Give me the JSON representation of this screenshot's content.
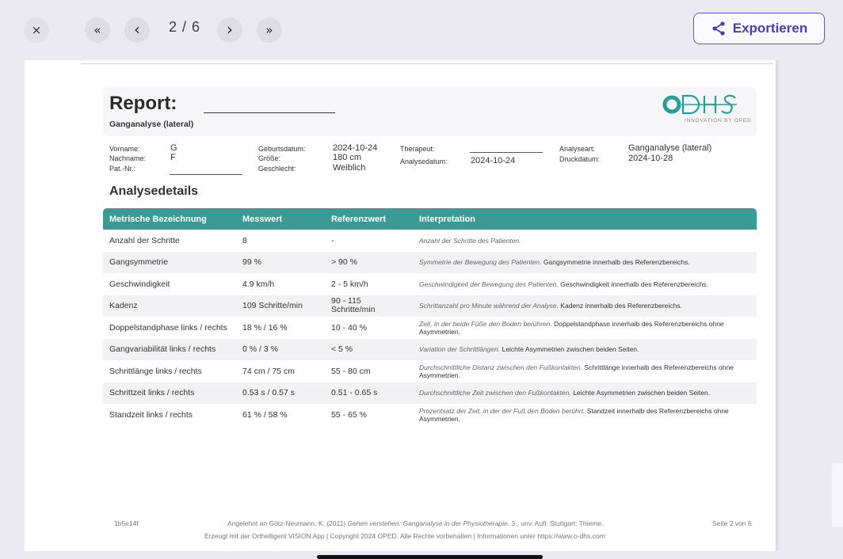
{
  "toolbar": {
    "close_icon": "×",
    "first_icon": "«",
    "prev_icon": "‹",
    "page_indicator": "2 / 6",
    "next_icon": "›",
    "last_icon": "»",
    "export_label": "Exportieren"
  },
  "report": {
    "title": "Report:",
    "subtitle": "Ganganalyse (lateral)",
    "logo_text": "ODHS",
    "logo_sub": "INNOVATION BY OPED"
  },
  "patient": {
    "vorname_label": "Vorname:",
    "vorname": "G",
    "nachname_label": "Nachname:",
    "nachname": "F",
    "patnr_label": "Pat.-Nr.:",
    "geburtsdatum_label": "Geburtsdatum:",
    "geburtsdatum": "2024-10-24",
    "groesse_label": "Größe:",
    "groesse": "180 cm",
    "geschlecht_label": "Geschlecht:",
    "geschlecht": "Weiblich",
    "therapeut_label": "Therapeut:",
    "analysedatum_label": "Analysedatum:",
    "analysedatum": "2024-10-24",
    "analyseart_label": "Analyseart:",
    "analyseart": "Ganganalyse (lateral)",
    "druckdatum_label": "Druckdatum:",
    "druckdatum": "2024-10-28"
  },
  "section_title": "Analysedetails",
  "table": {
    "headers": [
      "Metrische Bezeichnung",
      "Messwert",
      "Referenzwert",
      "Interpretation"
    ],
    "rows": [
      {
        "name": "Anzahl der Schritte",
        "value": "8",
        "ref": "-",
        "interp_it": "Anzahl der Schritte des Patienten.",
        "interp": ""
      },
      {
        "name": "Gangsymmetrie",
        "value": "99 %",
        "ref": "> 90 %",
        "interp_it": "Symmetrie der Bewegung des Patienten.",
        "interp": "Gangsymmetrie innerhalb des Referenzbereichs."
      },
      {
        "name": "Geschwindigkeit",
        "value": "4.9 km/h",
        "ref": "2 - 5 km/h",
        "interp_it": "Geschwindigkeit der Bewegung des Patienten.",
        "interp": "Geschwindigkeit innerhalb des Referenzbereichs."
      },
      {
        "name": "Kadenz",
        "value": "109 Schritte/min",
        "ref": "90 - 115 Schritte/min",
        "interp_it": "Schrittanzahl pro Minute während der Analyse.",
        "interp": "Kadenz innerhalb des Referenzbereichs."
      },
      {
        "name": "Doppelstandphase links / rechts",
        "value": "18 % / 16 %",
        "ref": "10 - 40 %",
        "interp_it": "Zeit, in der beide Füße den Boden berühren.",
        "interp": "Doppelstandphase innerhalb des Referenzbereichs ohne Asymmetrien."
      },
      {
        "name": "Gangvariabilität links / rechts",
        "value": "0 % / 3 %",
        "ref": "< 5 %",
        "interp_it": "Variation der Schrittlängen.",
        "interp": "Leichte Asymmetrien zwischen beiden Seiten."
      },
      {
        "name": "Schrittlänge links / rechts",
        "value": "74 cm / 75 cm",
        "ref": "55 - 80 cm",
        "interp_it": "Durchschnittliche Distanz zwischen den Fußkontakten.",
        "interp": "Schrittlänge innerhalb des Referenzbereichs ohne Asymmetrien."
      },
      {
        "name": "Schrittzeit links / rechts",
        "value": "0.53 s / 0.57 s",
        "ref": "0.51 - 0.65 s",
        "interp_it": "Durchschnittliche Zeit zwischen den Fußkontakten.",
        "interp": "Leichte Asymmetrien zwischen beiden Seiten."
      },
      {
        "name": "Standzeit links / rechts",
        "value": "61 % / 58 %",
        "ref": "55 - 65 %",
        "interp_it": "Prozentsatz der Zeit, in der der Fuß den Boden berührt.",
        "interp": "Standzeit innerhalb des Referenzbereichs ohne Asymmetrien."
      }
    ]
  },
  "footer": {
    "id": "1b5e14f",
    "ref_pre": "Angelehnt an Götz-Neumann, K. (2011)",
    "ref_it": "Gehen verstehen: Ganganalyse in der Physiotherapie",
    "ref_post": ". 3., unv. Aufl. Stuttgart: Thieme.",
    "copyright": "Erzeugt mit der Orthelligent VISION App | Copyright 2024 OPED. Alle Rechte vorbehalten | Informationen unter https://www.o-dhs.com",
    "page": "Seite 2 von 6"
  },
  "colors": {
    "accent": "#3c9a94",
    "export": "#4a3eb5"
  }
}
